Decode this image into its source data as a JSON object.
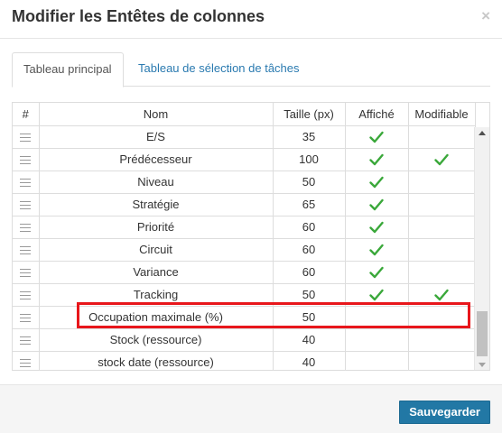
{
  "dialog": {
    "title": "Modifier les Entêtes de colonnes",
    "close_label": "×"
  },
  "tabs": [
    {
      "label": "Tableau principal",
      "active": true
    },
    {
      "label": "Tableau de sélection de tâches",
      "active": false
    }
  ],
  "columns": {
    "hash": "#",
    "nom": "Nom",
    "taille": "Taille (px)",
    "affiche": "Affiché",
    "modifiable": "Modifiable"
  },
  "rows": [
    {
      "nom": "E/S",
      "taille": "35",
      "affiche": true,
      "modifiable": false
    },
    {
      "nom": "Prédécesseur",
      "taille": "100",
      "affiche": true,
      "modifiable": true
    },
    {
      "nom": "Niveau",
      "taille": "50",
      "affiche": true,
      "modifiable": false
    },
    {
      "nom": "Stratégie",
      "taille": "65",
      "affiche": true,
      "modifiable": false
    },
    {
      "nom": "Priorité",
      "taille": "60",
      "affiche": true,
      "modifiable": false
    },
    {
      "nom": "Circuit",
      "taille": "60",
      "affiche": true,
      "modifiable": false
    },
    {
      "nom": "Variance",
      "taille": "60",
      "affiche": true,
      "modifiable": false
    },
    {
      "nom": "Tracking",
      "taille": "50",
      "affiche": true,
      "modifiable": true
    },
    {
      "nom": "Occupation maximale (%)",
      "taille": "50",
      "affiche": false,
      "modifiable": false
    },
    {
      "nom": "Stock (ressource)",
      "taille": "40",
      "affiche": false,
      "modifiable": false
    },
    {
      "nom": "stock date (ressource)",
      "taille": "40",
      "affiche": false,
      "modifiable": false
    }
  ],
  "footer": {
    "save_label": "Sauvegarder"
  },
  "colors": {
    "accent": "#2278a5",
    "highlight": "#e8161b",
    "check": "#3aa83a"
  }
}
